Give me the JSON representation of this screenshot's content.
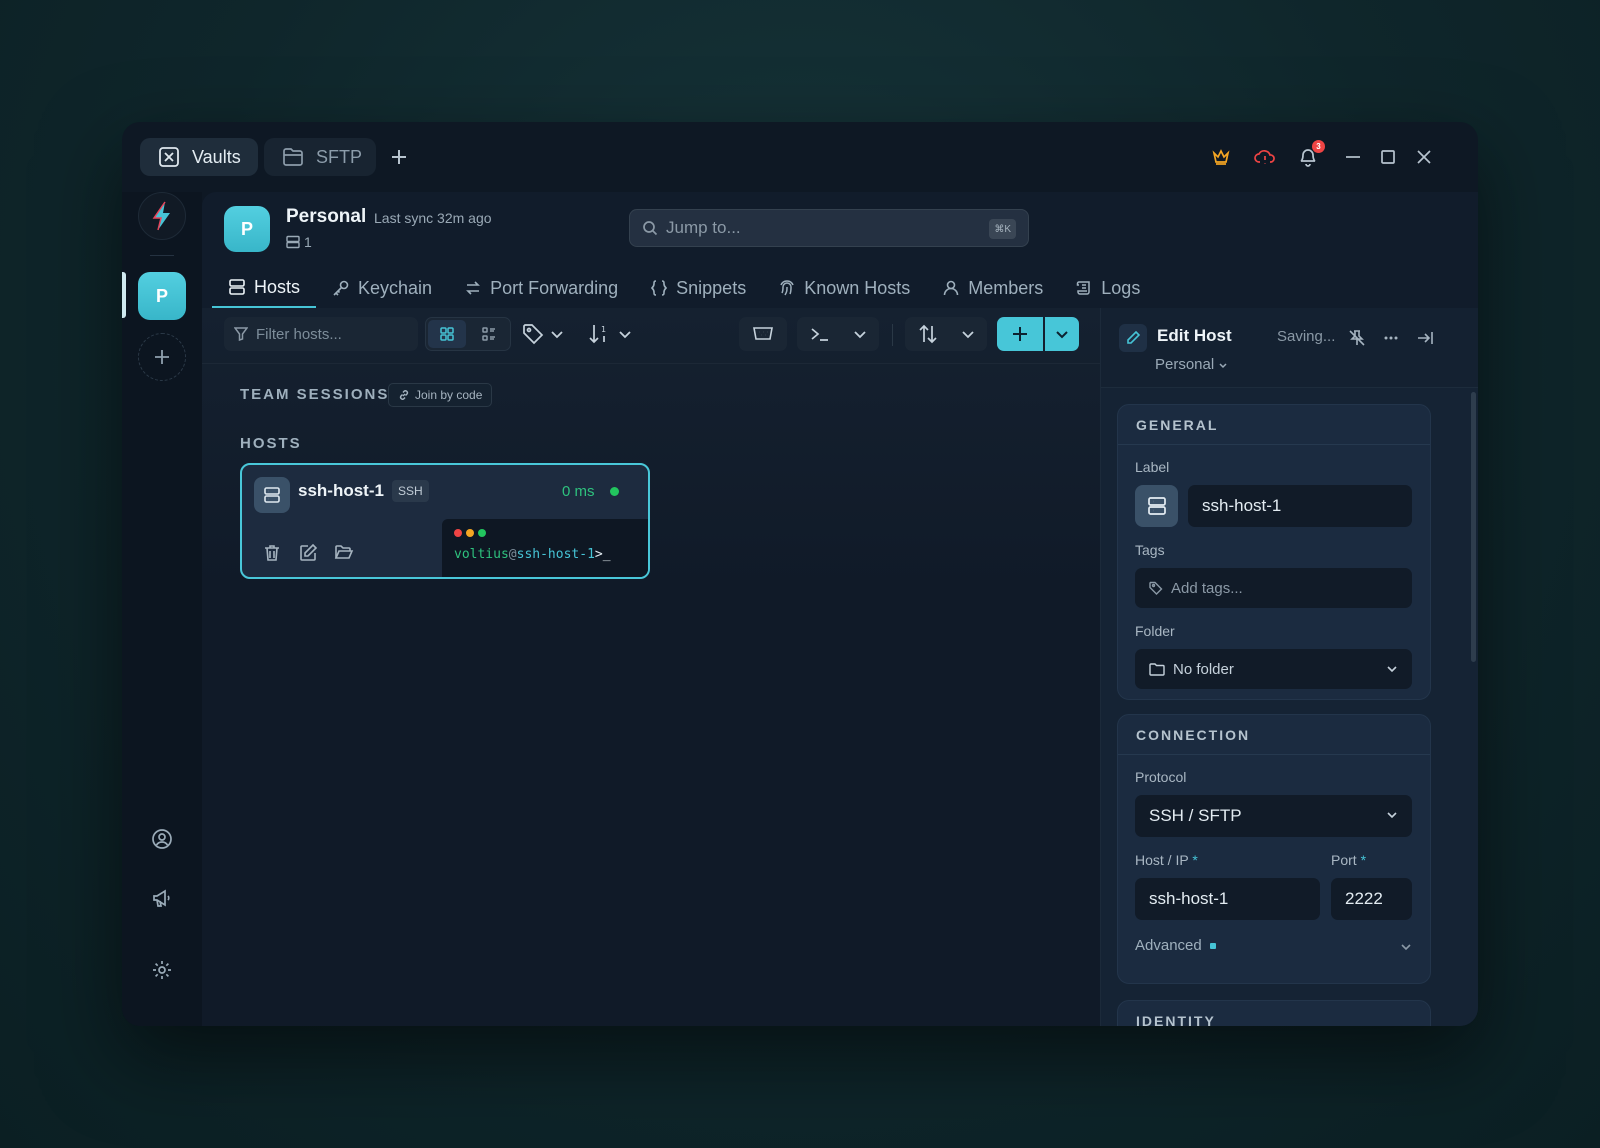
{
  "titlebar": {
    "tabs": [
      {
        "label": "Vaults",
        "icon": "vault-icon"
      },
      {
        "label": "SFTP",
        "icon": "folder-icon"
      }
    ],
    "notification_count": "3",
    "colors": {
      "crown": "#f5a623",
      "cloud_alert": "#ef4444"
    }
  },
  "rail": {
    "vault_initial": "P"
  },
  "vault": {
    "initial": "P",
    "name": "Personal",
    "sync": "Last sync 32m ago",
    "host_count": "1"
  },
  "search": {
    "placeholder": "Jump to...",
    "shortcut": "⌘K"
  },
  "nav": {
    "tabs": [
      {
        "label": "Hosts",
        "active": true
      },
      {
        "label": "Keychain"
      },
      {
        "label": "Port Forwarding"
      },
      {
        "label": "Snippets"
      },
      {
        "label": "Known Hosts"
      },
      {
        "label": "Members"
      },
      {
        "label": "Logs"
      }
    ]
  },
  "toolbar": {
    "filter_placeholder": "Filter hosts...",
    "view_mode": "grid"
  },
  "sections": {
    "team_sessions": "TEAM SESSIONS",
    "join_by_code": "Join by code",
    "hosts": "HOSTS"
  },
  "host_card": {
    "name": "ssh-host-1",
    "protocol": "SSH",
    "latency": "0 ms",
    "status": "online",
    "terminal": {
      "user": "voltius",
      "at": "@",
      "host": "ssh-host-1",
      "prompt": ">_"
    }
  },
  "panel": {
    "title": "Edit Host",
    "status": "Saving...",
    "vault": "Personal",
    "general": {
      "heading": "GENERAL",
      "label_label": "Label",
      "label_value": "ssh-host-1",
      "tags_label": "Tags",
      "tags_placeholder": "Add tags...",
      "folder_label": "Folder",
      "folder_value": "No folder"
    },
    "connection": {
      "heading": "CONNECTION",
      "protocol_label": "Protocol",
      "protocol_value": "SSH / SFTP",
      "host_label": "Host / IP",
      "host_value": "ssh-host-1",
      "port_label": "Port",
      "port_value": "2222",
      "required_mark": "*",
      "advanced_label": "Advanced"
    },
    "identity_heading": "IDENTITY"
  }
}
